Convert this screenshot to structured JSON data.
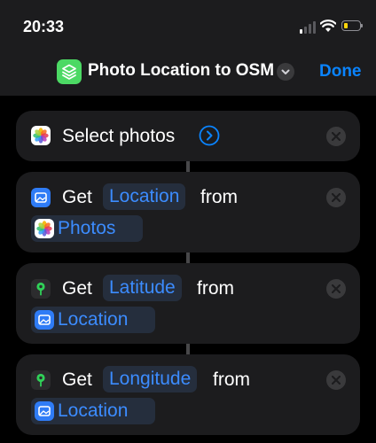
{
  "status_bar": {
    "time": "20:33"
  },
  "nav": {
    "title": "Photo Location to OSM",
    "done_label": "Done"
  },
  "actions": [
    {
      "verb": "Select photos"
    },
    {
      "verb": "Get",
      "property": "Location",
      "connector": "from",
      "source": "Photos"
    },
    {
      "verb": "Get",
      "property": "Latitude",
      "connector": "from",
      "source": "Location"
    },
    {
      "verb": "Get",
      "property": "Longitude",
      "connector": "from",
      "source": "Location"
    }
  ],
  "colors": {
    "accent": "#0a84ff",
    "token_text": "#3c8cff",
    "token_bg": "#252e3d",
    "card_bg": "#1c1c1e",
    "shortcut_icon": "#4cd964",
    "location_pin": "#30d158",
    "battery": "#ffd60a"
  }
}
